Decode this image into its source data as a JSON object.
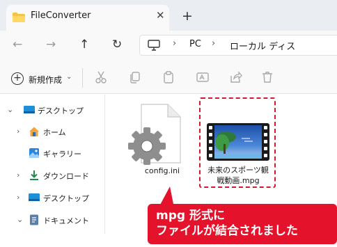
{
  "window": {
    "tab_title": "FileConverter",
    "tab_close": "✕",
    "new_tab": "+"
  },
  "nav": {
    "back": "←",
    "forward": "→",
    "up": "↑",
    "refresh": "↻",
    "breadcrumbs": [
      "PC",
      "ローカル ディス"
    ]
  },
  "toolbar": {
    "new_label": "新規作成",
    "new_caret": "⌄",
    "icons": [
      "cut-icon",
      "copy-icon",
      "paste-icon",
      "rename-icon",
      "share-icon",
      "delete-icon"
    ]
  },
  "sidebar": {
    "items": [
      {
        "label": "デスクトップ",
        "chevron": "⌄",
        "icon": "desktop-icon"
      },
      {
        "label": "ホーム",
        "chevron": "›",
        "icon": "home-icon"
      },
      {
        "label": "ギャラリー",
        "chevron": "",
        "icon": "gallery-icon"
      },
      {
        "label": "ダウンロード",
        "chevron": "›",
        "icon": "download-icon"
      },
      {
        "label": "デスクトップ",
        "chevron": "›",
        "icon": "desktop-icon"
      },
      {
        "label": "ドキュメント",
        "chevron": "⌄",
        "icon": "document-icon"
      }
    ]
  },
  "files": [
    {
      "name": "config.ini",
      "icon": "settings-file-icon"
    },
    {
      "name_line1": "未来のスポーツ観",
      "name_line2": "戦動画.mpg",
      "icon": "video-file-icon",
      "selected": true
    }
  ],
  "callout": {
    "line1": "mpg 形式に",
    "line2": "ファイルが結合されました",
    "color": "#e4122a"
  },
  "colors": {
    "accent": "#0067c0",
    "highlight": "#d6162e"
  }
}
